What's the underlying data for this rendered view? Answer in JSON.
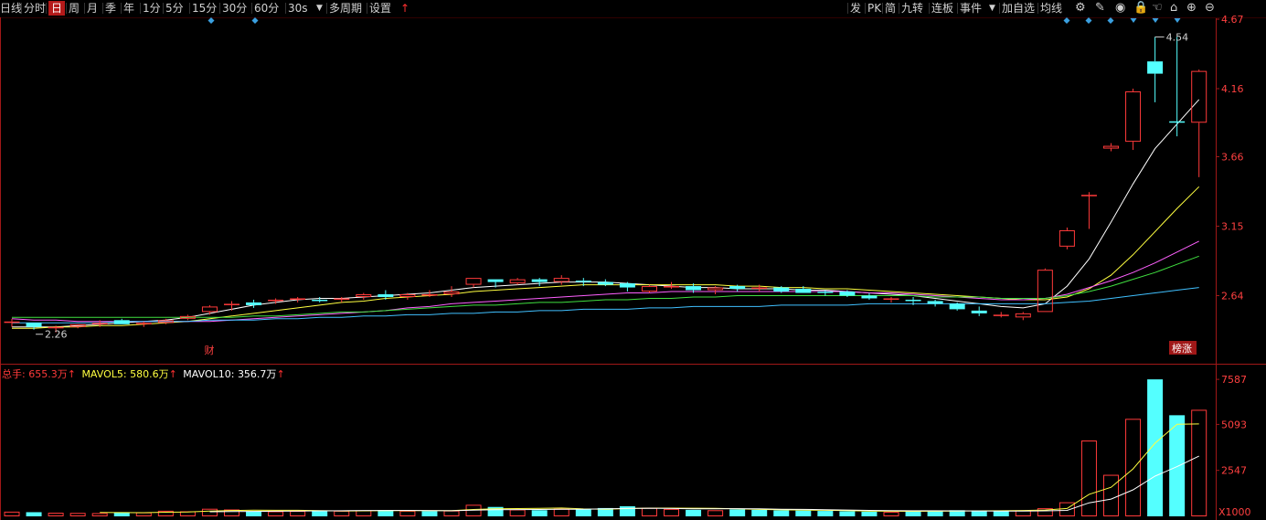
{
  "toolbar": {
    "left_items": [
      "日线",
      "分时",
      "日",
      "周",
      "月",
      "季",
      "年",
      "1分",
      "5分",
      "15分",
      "30分",
      "60分",
      "30s",
      "多周期",
      "设置"
    ],
    "active": "日",
    "right_items": [
      "发",
      "PK",
      "简",
      "九转",
      "连板",
      "事件",
      "加自选",
      "均线"
    ],
    "arrow": "↑"
  },
  "colors": {
    "bg": "#000000",
    "up": "#ff3a3a",
    "down": "#54ffff",
    "grid": "#3a0000",
    "axis": "#a01818",
    "ma5": "#ffffff",
    "ma10": "#ffff40",
    "ma20": "#ff60ff",
    "ma30": "#40e040",
    "ma60": "#40c0ff",
    "vol_ma5": "#ffff40",
    "vol_ma10": "#ffffff"
  },
  "icons": [
    "gear-icon",
    "pen-icon",
    "eye-icon",
    "lock-icon",
    "hand-icon",
    "unlock-icon",
    "zoom-in-icon",
    "zoom-out-icon"
  ],
  "price_axis": {
    "ticks": [
      "4.67",
      "4.16",
      "3.66",
      "3.15",
      "2.64"
    ]
  },
  "annotations": {
    "high": "4.54",
    "low": "2.26",
    "fin_tag": "财",
    "limit_tag": "榜涨"
  },
  "volume": {
    "legend": {
      "total_label": "总手:",
      "total_value": "655.3万",
      "ma5_label": "MAVOL5:",
      "ma5_value": "580.6万",
      "ma10_label": "MAVOL10:",
      "ma10_value": "356.7万"
    },
    "axis_ticks": [
      "7587",
      "5093",
      "2547"
    ],
    "unit": "X1000"
  },
  "chart_data": [
    {
      "type": "candlestick",
      "ylim": [
        2.14,
        4.67
      ],
      "candles": [
        [
          2.44,
          2.47,
          2.41,
          2.45
        ],
        [
          2.44,
          2.44,
          2.39,
          2.41
        ],
        [
          2.4,
          2.42,
          2.37,
          2.41
        ],
        [
          2.41,
          2.43,
          2.4,
          2.43
        ],
        [
          2.43,
          2.46,
          2.41,
          2.44
        ],
        [
          2.46,
          2.47,
          2.43,
          2.43
        ],
        [
          2.43,
          2.45,
          2.41,
          2.44
        ],
        [
          2.44,
          2.47,
          2.43,
          2.46
        ],
        [
          2.47,
          2.5,
          2.46,
          2.49
        ],
        [
          2.52,
          2.57,
          2.5,
          2.56
        ],
        [
          2.57,
          2.6,
          2.53,
          2.58
        ],
        [
          2.59,
          2.61,
          2.55,
          2.57
        ],
        [
          2.6,
          2.62,
          2.58,
          2.61
        ],
        [
          2.61,
          2.63,
          2.59,
          2.62
        ],
        [
          2.61,
          2.63,
          2.59,
          2.6
        ],
        [
          2.61,
          2.63,
          2.59,
          2.62
        ],
        [
          2.63,
          2.66,
          2.61,
          2.65
        ],
        [
          2.65,
          2.68,
          2.61,
          2.63
        ],
        [
          2.63,
          2.66,
          2.61,
          2.65
        ],
        [
          2.65,
          2.68,
          2.63,
          2.65
        ],
        [
          2.65,
          2.71,
          2.63,
          2.67
        ],
        [
          2.72,
          2.77,
          2.7,
          2.77
        ],
        [
          2.76,
          2.76,
          2.7,
          2.74
        ],
        [
          2.73,
          2.77,
          2.72,
          2.76
        ],
        [
          2.76,
          2.77,
          2.71,
          2.74
        ],
        [
          2.74,
          2.79,
          2.72,
          2.77
        ],
        [
          2.75,
          2.77,
          2.71,
          2.74
        ],
        [
          2.74,
          2.76,
          2.71,
          2.72
        ],
        [
          2.73,
          2.74,
          2.67,
          2.7
        ],
        [
          2.67,
          2.72,
          2.66,
          2.71
        ],
        [
          2.7,
          2.74,
          2.69,
          2.71
        ],
        [
          2.71,
          2.73,
          2.66,
          2.68
        ],
        [
          2.68,
          2.71,
          2.65,
          2.7
        ],
        [
          2.71,
          2.72,
          2.67,
          2.69
        ],
        [
          2.7,
          2.72,
          2.67,
          2.7
        ],
        [
          2.7,
          2.71,
          2.66,
          2.67
        ],
        [
          2.69,
          2.71,
          2.66,
          2.66
        ],
        [
          2.67,
          2.68,
          2.64,
          2.66
        ],
        [
          2.67,
          2.68,
          2.63,
          2.64
        ],
        [
          2.64,
          2.66,
          2.61,
          2.62
        ],
        [
          2.61,
          2.63,
          2.59,
          2.62
        ],
        [
          2.61,
          2.63,
          2.57,
          2.6
        ],
        [
          2.6,
          2.61,
          2.56,
          2.58
        ],
        [
          2.58,
          2.59,
          2.53,
          2.54
        ],
        [
          2.53,
          2.56,
          2.49,
          2.51
        ],
        [
          2.5,
          2.52,
          2.48,
          2.5
        ],
        [
          2.48,
          2.52,
          2.46,
          2.51
        ],
        [
          2.52,
          2.84,
          2.52,
          2.83
        ],
        [
          3.0,
          3.14,
          2.98,
          3.12
        ],
        [
          3.38,
          3.4,
          3.13,
          3.38
        ],
        [
          3.72,
          3.76,
          3.7,
          3.74
        ],
        [
          3.77,
          4.16,
          3.71,
          4.14
        ],
        [
          4.36,
          4.54,
          4.06,
          4.27
        ],
        [
          3.92,
          4.54,
          3.81,
          3.91
        ],
        [
          3.91,
          4.3,
          3.51,
          4.29
        ]
      ],
      "ma": [
        {
          "name": "MA5",
          "values": [
            2.41,
            2.41,
            2.41,
            2.42,
            2.43,
            2.44,
            2.45,
            2.46,
            2.48,
            2.51,
            2.54,
            2.57,
            2.59,
            2.61,
            2.62,
            2.62,
            2.63,
            2.64,
            2.65,
            2.66,
            2.68,
            2.7,
            2.71,
            2.72,
            2.73,
            2.74,
            2.74,
            2.74,
            2.73,
            2.72,
            2.71,
            2.7,
            2.7,
            2.69,
            2.69,
            2.69,
            2.68,
            2.68,
            2.67,
            2.66,
            2.65,
            2.64,
            2.62,
            2.6,
            2.58,
            2.56,
            2.55,
            2.58,
            2.71,
            2.91,
            3.18,
            3.46,
            3.72,
            3.9,
            4.08
          ]
        },
        {
          "name": "MA10",
          "values": [
            2.4,
            2.4,
            2.41,
            2.41,
            2.42,
            2.42,
            2.43,
            2.44,
            2.45,
            2.47,
            2.49,
            2.51,
            2.53,
            2.55,
            2.57,
            2.59,
            2.6,
            2.62,
            2.63,
            2.64,
            2.65,
            2.67,
            2.68,
            2.69,
            2.7,
            2.71,
            2.72,
            2.72,
            2.72,
            2.72,
            2.72,
            2.72,
            2.72,
            2.71,
            2.71,
            2.7,
            2.7,
            2.69,
            2.69,
            2.68,
            2.67,
            2.66,
            2.65,
            2.64,
            2.63,
            2.62,
            2.61,
            2.61,
            2.63,
            2.69,
            2.79,
            2.94,
            3.11,
            3.28,
            3.44
          ]
        },
        {
          "name": "MA20",
          "values": [
            2.47,
            2.46,
            2.46,
            2.45,
            2.45,
            2.45,
            2.45,
            2.45,
            2.45,
            2.45,
            2.46,
            2.47,
            2.48,
            2.49,
            2.5,
            2.51,
            2.52,
            2.53,
            2.55,
            2.56,
            2.58,
            2.59,
            2.6,
            2.61,
            2.62,
            2.63,
            2.64,
            2.65,
            2.66,
            2.66,
            2.67,
            2.67,
            2.67,
            2.67,
            2.67,
            2.67,
            2.67,
            2.67,
            2.67,
            2.66,
            2.66,
            2.65,
            2.64,
            2.63,
            2.62,
            2.61,
            2.61,
            2.62,
            2.65,
            2.7,
            2.75,
            2.81,
            2.88,
            2.96,
            3.04
          ]
        },
        {
          "name": "MA30",
          "values": [
            2.48,
            2.48,
            2.48,
            2.48,
            2.48,
            2.48,
            2.48,
            2.48,
            2.48,
            2.48,
            2.48,
            2.49,
            2.49,
            2.5,
            2.51,
            2.52,
            2.52,
            2.53,
            2.54,
            2.55,
            2.56,
            2.57,
            2.57,
            2.58,
            2.59,
            2.59,
            2.6,
            2.61,
            2.61,
            2.62,
            2.62,
            2.63,
            2.63,
            2.64,
            2.64,
            2.64,
            2.64,
            2.64,
            2.64,
            2.64,
            2.64,
            2.64,
            2.63,
            2.63,
            2.63,
            2.62,
            2.62,
            2.62,
            2.64,
            2.67,
            2.71,
            2.76,
            2.81,
            2.87,
            2.93
          ]
        },
        {
          "name": "MA60",
          "values": [
            2.44,
            2.44,
            2.44,
            2.44,
            2.44,
            2.45,
            2.45,
            2.45,
            2.45,
            2.46,
            2.46,
            2.46,
            2.47,
            2.47,
            2.48,
            2.48,
            2.49,
            2.49,
            2.5,
            2.5,
            2.51,
            2.51,
            2.52,
            2.52,
            2.53,
            2.53,
            2.54,
            2.54,
            2.54,
            2.55,
            2.55,
            2.56,
            2.56,
            2.56,
            2.56,
            2.57,
            2.57,
            2.57,
            2.57,
            2.58,
            2.58,
            2.58,
            2.58,
            2.58,
            2.58,
            2.58,
            2.58,
            2.58,
            2.59,
            2.6,
            2.62,
            2.64,
            2.66,
            2.68,
            2.7
          ]
        }
      ]
    },
    {
      "type": "bar",
      "ylim": [
        0,
        8200
      ],
      "values": [
        260,
        230,
        200,
        190,
        180,
        230,
        220,
        310,
        280,
        420,
        380,
        290,
        280,
        300,
        300,
        310,
        330,
        350,
        310,
        290,
        320,
        640,
        520,
        380,
        340,
        420,
        380,
        460,
        560,
        470,
        410,
        360,
        340,
        380,
        360,
        330,
        320,
        300,
        280,
        260,
        250,
        290,
        310,
        340,
        330,
        300,
        330,
        450,
        780,
        4200,
        2300,
        5400,
        7587,
        5600,
        5900
      ],
      "up": [
        true,
        false,
        true,
        true,
        true,
        false,
        true,
        true,
        true,
        true,
        true,
        false,
        true,
        true,
        false,
        true,
        true,
        false,
        true,
        false,
        true,
        true,
        false,
        true,
        false,
        true,
        false,
        false,
        false,
        true,
        true,
        false,
        true,
        false,
        false,
        false,
        false,
        false,
        false,
        false,
        true,
        false,
        false,
        false,
        false,
        false,
        true,
        true,
        true,
        true,
        true,
        true,
        false,
        false,
        true
      ],
      "ma": [
        {
          "name": "MAVOL5",
          "values": [
            null,
            null,
            null,
            null,
            212,
            206,
            204,
            226,
            244,
            292,
            322,
            340,
            334,
            336,
            316,
            298,
            304,
            318,
            320,
            316,
            320,
            382,
            416,
            432,
            440,
            460,
            408,
            392,
            432,
            458,
            456,
            448,
            438,
            418,
            384,
            360,
            348,
            332,
            316,
            296,
            282,
            280,
            282,
            292,
            302,
            310,
            322,
            350,
            436,
            1222,
            1612,
            2626,
            4053,
            5101,
            5117
          ]
        },
        {
          "name": "MAVOL10",
          "values": [
            null,
            null,
            null,
            null,
            null,
            null,
            null,
            null,
            null,
            252,
            264,
            273,
            283,
            287,
            304,
            310,
            322,
            326,
            328,
            316,
            309,
            343,
            367,
            376,
            378,
            390,
            397,
            413,
            436,
            449,
            433,
            420,
            414,
            425,
            421,
            396,
            384,
            368,
            349,
            329,
            315,
            311,
            307,
            306,
            299,
            291,
            293,
            302,
            330,
            749,
            958,
            1466,
            2229,
            2752,
            3336
          ]
        }
      ]
    }
  ]
}
